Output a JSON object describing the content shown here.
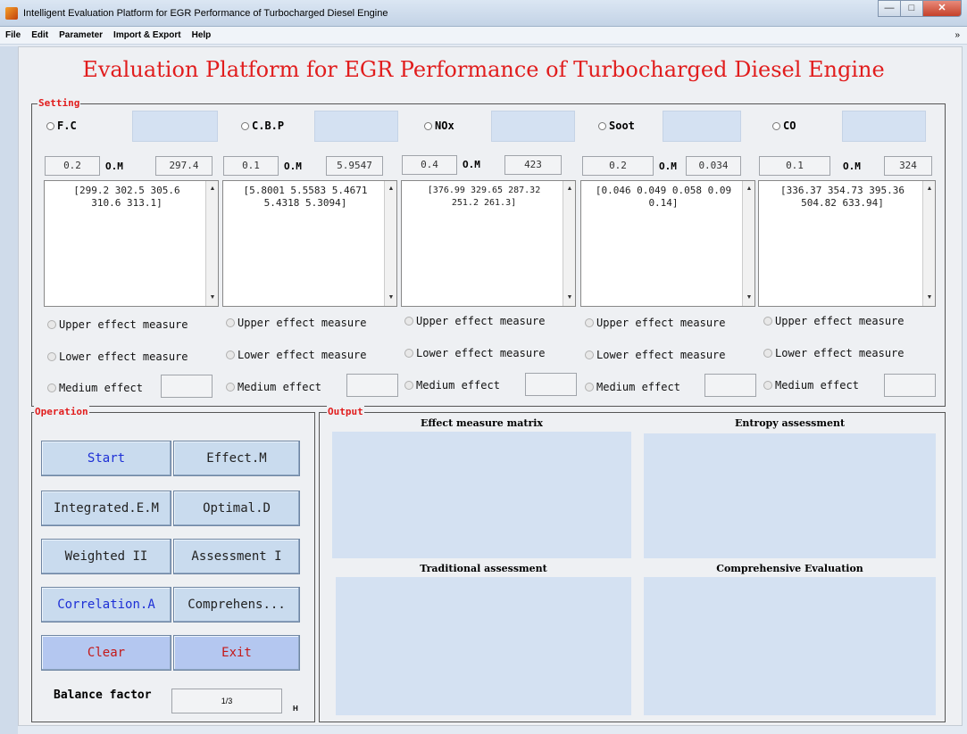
{
  "window": {
    "title": "Intelligent Evaluation Platform for EGR Performance of Turbocharged Diesel Engine",
    "controls": [
      "—",
      "□",
      "✕"
    ]
  },
  "menu": {
    "items": [
      "File",
      "Edit",
      "Parameter",
      "Import & Export",
      "Help"
    ],
    "overflow": "»"
  },
  "main_title": "Evaluation Platform for EGR Performance of Turbocharged Diesel Engine",
  "setting": {
    "legend": "Setting",
    "om_label": "O.M",
    "upper_label": "Upper effect measure",
    "lower_label": "Lower effect measure",
    "medium_label": "Medium effect",
    "columns": [
      {
        "name": "F.C",
        "weight": "0.2",
        "om": "297.4",
        "values": "[299.2 302.5 305.6\n310.6 313.1]"
      },
      {
        "name": "C.B.P",
        "weight": "0.1",
        "om": "5.9547",
        "values": "[5.8001 5.5583 5.4671\n5.4318 5.3094]"
      },
      {
        "name": "NOx",
        "weight": "0.4",
        "om": "423",
        "values": "[376.99 329.65 287.32\n251.2 261.3]"
      },
      {
        "name": "Soot",
        "weight": "0.2",
        "om": "0.034",
        "values": "[0.046 0.049 0.058 0.09\n0.14]"
      },
      {
        "name": "CO",
        "weight": "0.1",
        "om": "324",
        "values": "[336.37 354.73 395.36\n504.82 633.94]"
      }
    ]
  },
  "operation": {
    "legend": "Operation",
    "buttons": {
      "start": "Start",
      "effect_m": "Effect.M",
      "integrated": "Integrated.E.M",
      "optimal": "Optimal.D",
      "weighted": "Weighted  II",
      "assessment": "Assessment  I",
      "correlation": "Correlation.A",
      "comprehensive": "Comprehens...",
      "clear": "Clear",
      "exit": "Exit"
    },
    "balance_label": "Balance factor",
    "balance_value": "1/3",
    "h_mark": "H"
  },
  "output": {
    "legend": "Output",
    "panels": {
      "effect_matrix": "Effect measure matrix",
      "entropy": "Entropy assessment",
      "traditional": "Traditional assessment",
      "comprehensive": "Comprehensive Evaluation"
    }
  }
}
